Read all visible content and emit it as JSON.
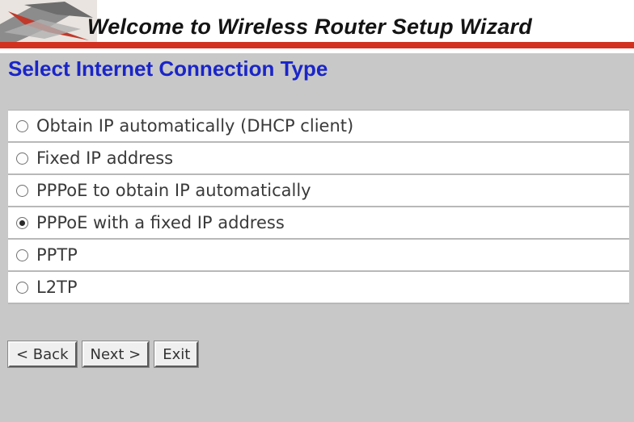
{
  "banner": {
    "title": "Welcome to Wireless Router Setup Wizard",
    "accent_color": "#d2311f"
  },
  "page": {
    "title": "Select Internet Connection Type",
    "title_color": "#1a25c8"
  },
  "connection_types": [
    {
      "label": "Obtain IP automatically (DHCP client)",
      "selected": false
    },
    {
      "label": "Fixed IP address",
      "selected": false
    },
    {
      "label": "PPPoE to obtain IP automatically",
      "selected": false
    },
    {
      "label": "PPPoE with a fixed IP address",
      "selected": true
    },
    {
      "label": "PPTP",
      "selected": false
    },
    {
      "label": "L2TP",
      "selected": false
    }
  ],
  "buttons": {
    "back": "< Back",
    "next": "Next >",
    "exit": "Exit"
  }
}
